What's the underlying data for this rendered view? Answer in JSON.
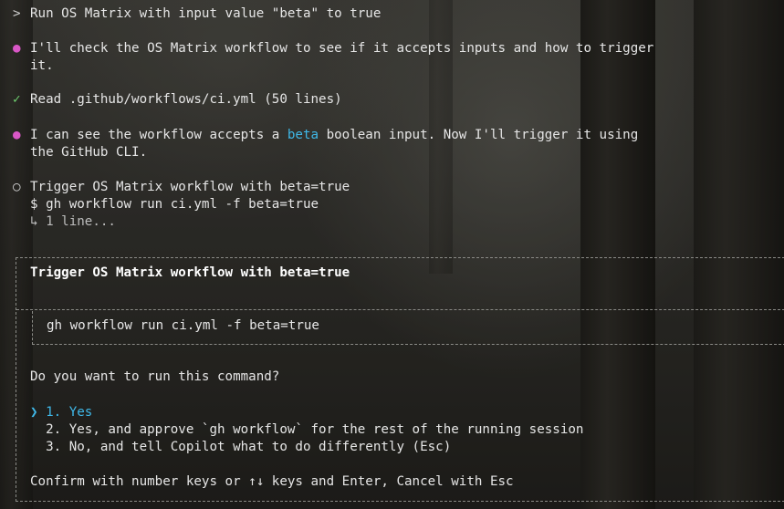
{
  "transcript": {
    "user_prompt_marker": ">",
    "user_prompt": "Run OS Matrix with input value \"beta\" to true",
    "msg1": {
      "marker": "●",
      "line1": "I'll check the OS Matrix workflow to see if it accepts inputs and how to trigger",
      "line2": "it."
    },
    "read": {
      "marker": "✓",
      "text": "Read .github/workflows/ci.yml (50 lines)"
    },
    "msg2": {
      "marker": "●",
      "pre": "I can see the workflow accepts a ",
      "highlight": "beta",
      "post": " boolean input. Now I'll trigger it using",
      "line2": "the GitHub CLI."
    },
    "tool": {
      "marker": "○",
      "title": "Trigger OS Matrix workflow with beta=true",
      "command": "$ gh workflow run ci.yml -f beta=true",
      "output": "↳ 1 line..."
    }
  },
  "dialog": {
    "title": "Trigger OS Matrix workflow with beta=true",
    "command": "gh workflow run ci.yml -f beta=true",
    "question": "Do you want to run this command?",
    "selected_marker": "❯",
    "options": [
      "1. Yes",
      "2. Yes, and approve `gh workflow` for the rest of the running session",
      "3. No, and tell Copilot what to do differently (Esc)"
    ],
    "footer": "Confirm with number keys or ↑↓ keys and Enter, Cancel with Esc"
  },
  "colors": {
    "bullet": "#d957c6",
    "check": "#6fcf6f",
    "accent": "#3fb8e8"
  }
}
